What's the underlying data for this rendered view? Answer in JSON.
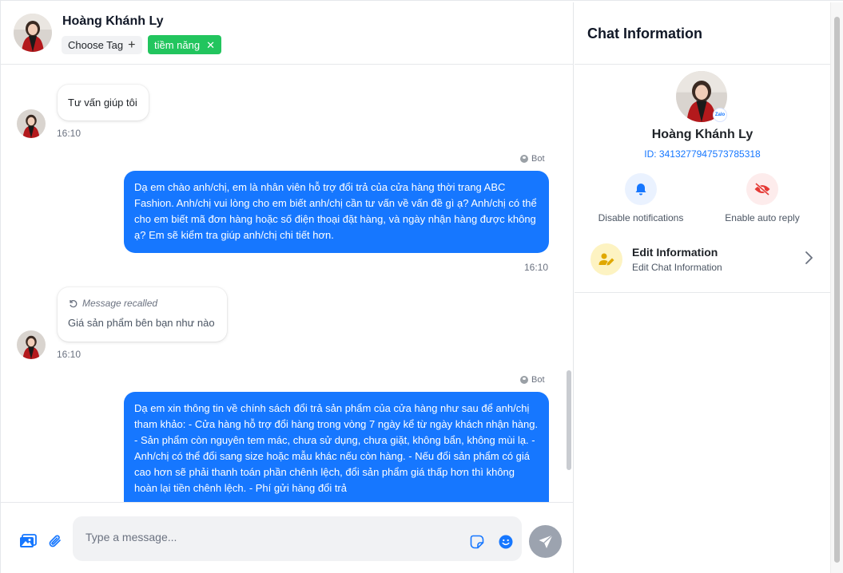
{
  "contact": {
    "name": "Hoàng Khánh Ly",
    "choose_tag_label": "Choose Tag",
    "tags": [
      {
        "label": "tiềm năng",
        "color": "#22c55e"
      }
    ]
  },
  "messages": [
    {
      "direction": "in",
      "text": "Tư vấn giúp tôi",
      "time": "16:10"
    },
    {
      "direction": "out",
      "sender": "Bot",
      "text": "Dạ em chào anh/chị, em là nhân viên hỗ trợ đổi trả của cửa hàng thời trang ABC Fashion. Anh/chị vui lòng cho em biết anh/chị cần tư vấn về vấn đề gì ạ? Anh/chị có thể cho em biết mã đơn hàng hoặc số điện thoại đặt hàng, và ngày nhận hàng được không ạ? Em sẽ kiểm tra giúp anh/chị chi tiết hơn.",
      "time": "16:10"
    },
    {
      "direction": "in",
      "recalled": true,
      "recalled_label": "Message recalled",
      "text": "Giá sản phẩm bên bạn như nào",
      "time": "16:10"
    },
    {
      "direction": "out",
      "sender": "Bot",
      "text": "Dạ em xin thông tin về chính sách đổi trả sản phẩm của cửa hàng như sau để anh/chị tham khảo: - Cửa hàng hỗ trợ đổi hàng trong vòng 7 ngày kể từ ngày khách nhận hàng. - Sản phẩm còn nguyên tem mác, chưa sử dụng, chưa giặt, không bẩn, không mùi lạ. - Anh/chị có thể đổi sang size hoặc mẫu khác nếu còn hàng. - Nếu đổi sản phẩm có giá cao hơn sẽ phải thanh toán phần chênh lệch, đổi sản phẩm giá thấp hơn thì không hoàn lại tiền chênh lệch. - Phí gửi hàng đổi trả"
    }
  ],
  "composer": {
    "placeholder": "Type a message..."
  },
  "info": {
    "title": "Chat Information",
    "name": "Hoàng Khánh Ly",
    "id_text": "ID: 3413277947573785318",
    "badge": "Zalo",
    "actions": [
      {
        "label": "Disable notifications",
        "icon": "bell-icon"
      },
      {
        "label": "Enable auto reply",
        "icon": "eye-off-icon"
      }
    ],
    "edit": {
      "title": "Edit Information",
      "subtitle": "Edit Chat Information"
    }
  },
  "colors": {
    "accent": "#1677ff",
    "tag": "#22c55e",
    "send_disabled": "#9ca3af",
    "edit_icon_bg": "#fdf3c2"
  }
}
